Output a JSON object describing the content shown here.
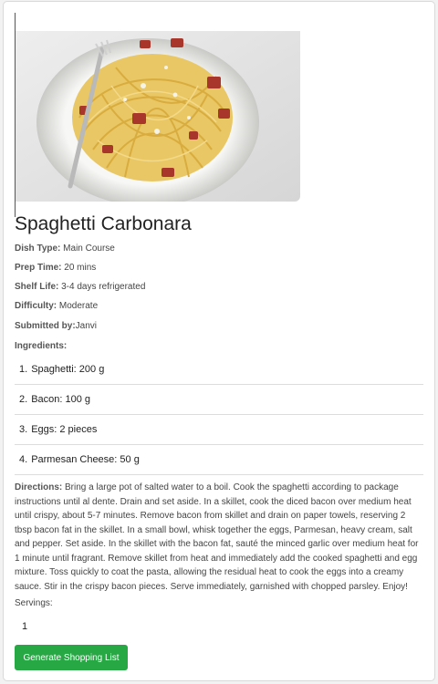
{
  "recipe": {
    "title": "Spaghetti Carbonara",
    "dish_type_label": "Dish Type:",
    "dish_type": "Main Course",
    "prep_time_label": "Prep Time:",
    "prep_time": "20 mins",
    "shelf_life_label": "Shelf Life:",
    "shelf_life": "3-4 days refrigerated",
    "difficulty_label": "Difficulty:",
    "difficulty": "Moderate",
    "submitted_by_label": "Submitted by:",
    "submitted_by": "Janvi",
    "ingredients_label": "Ingredients:",
    "ingredients": [
      {
        "num": "1.",
        "text": "Spaghetti: 200 g"
      },
      {
        "num": "2.",
        "text": "Bacon: 100 g"
      },
      {
        "num": "3.",
        "text": "Eggs: 2 pieces"
      },
      {
        "num": "4.",
        "text": "Parmesan Cheese: 50 g"
      }
    ],
    "directions_label": "Directions:",
    "directions": "Bring a large pot of salted water to a boil. Cook the spaghetti according to package instructions until al dente. Drain and set aside. In a skillet, cook the diced bacon over medium heat until crispy, about 5-7 minutes. Remove bacon from skillet and drain on paper towels, reserving 2 tbsp bacon fat in the skillet. In a small bowl, whisk together the eggs, Parmesan, heavy cream, salt and pepper. Set aside. In the skillet with the bacon fat, sauté the minced garlic over medium heat for 1 minute until fragrant. Remove skillet from heat and immediately add the cooked spaghetti and egg mixture. Toss quickly to coat the pasta, allowing the residual heat to cook the eggs into a creamy sauce. Stir in the crispy bacon pieces. Serve immediately, garnished with chopped parsley. Enjoy!",
    "servings_label": "Servings:",
    "servings_value": "1"
  },
  "actions": {
    "generate_label": "Generate Shopping List"
  },
  "colors": {
    "button_green": "#28a745"
  }
}
